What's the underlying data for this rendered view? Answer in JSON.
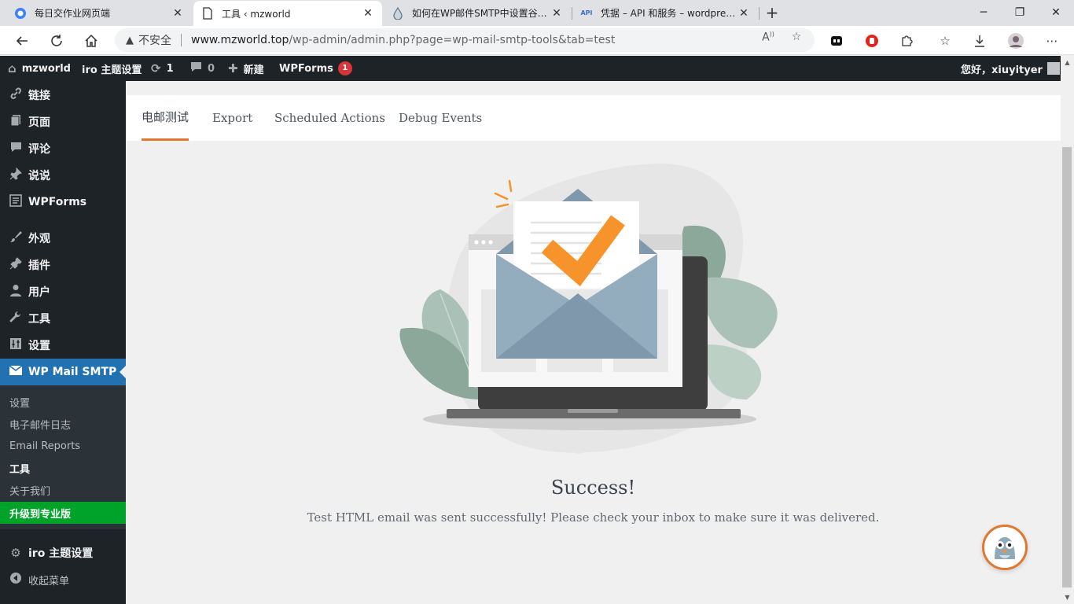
{
  "browser": {
    "tabs": [
      {
        "title": "每日交作业网页端",
        "icon": "globe-icon"
      },
      {
        "title": "工具 ‹ mzworld",
        "icon": "page-icon"
      },
      {
        "title": "如何在WP邮件SMTP中设置谷歌邮箱",
        "icon": "drop-icon"
      },
      {
        "title": "凭据 – API 和服务 – wordpress –",
        "icon": "api-icon"
      }
    ],
    "api_favicon": "API",
    "security_label": "不安全",
    "url_host": "www.mzworld.top",
    "url_path": "/wp-admin/admin.php?page=wp-mail-smtp-tools&tab=test"
  },
  "adminbar": {
    "site": "mzworld",
    "theme": "iro 主题设置",
    "updates": "1",
    "comments": "0",
    "new": "新建",
    "wpforms": "WPForms",
    "wpforms_badge": "1",
    "greeting": "您好，xiuyityer"
  },
  "sidebar": {
    "items": [
      {
        "label": "链接",
        "icon": "link-icon"
      },
      {
        "label": "页面",
        "icon": "page-icon"
      },
      {
        "label": "评论",
        "icon": "comment-icon"
      },
      {
        "label": "说说",
        "icon": "pin-icon"
      },
      {
        "label": "WPForms",
        "icon": "form-icon"
      },
      {
        "label": "外观",
        "icon": "brush-icon"
      },
      {
        "label": "插件",
        "icon": "plugin-icon"
      },
      {
        "label": "用户",
        "icon": "user-icon"
      },
      {
        "label": "工具",
        "icon": "wrench-icon"
      },
      {
        "label": "设置",
        "icon": "settings-icon"
      },
      {
        "label": "WP Mail SMTP",
        "icon": "mail-icon"
      }
    ],
    "submenu": [
      {
        "label": "设置"
      },
      {
        "label": "电子邮件日志"
      },
      {
        "label": "Email Reports"
      },
      {
        "label": "工具"
      },
      {
        "label": "关于我们"
      },
      {
        "label": "升级到专业版"
      }
    ],
    "iro_settings": "iro 主题设置",
    "collapse": "收起菜单"
  },
  "main": {
    "tabs": [
      {
        "label": "电邮测试"
      },
      {
        "label": "Export"
      },
      {
        "label": "Scheduled Actions"
      },
      {
        "label": "Debug Events"
      }
    ],
    "success_title": "Success!",
    "success_message": "Test HTML email was sent successfully! Please check your inbox to make sure it was delivered."
  },
  "colors": {
    "accent": "#e27730",
    "wp_blue": "#2271b1",
    "upgrade_green": "#00a32a",
    "dark": "#1d2327"
  }
}
